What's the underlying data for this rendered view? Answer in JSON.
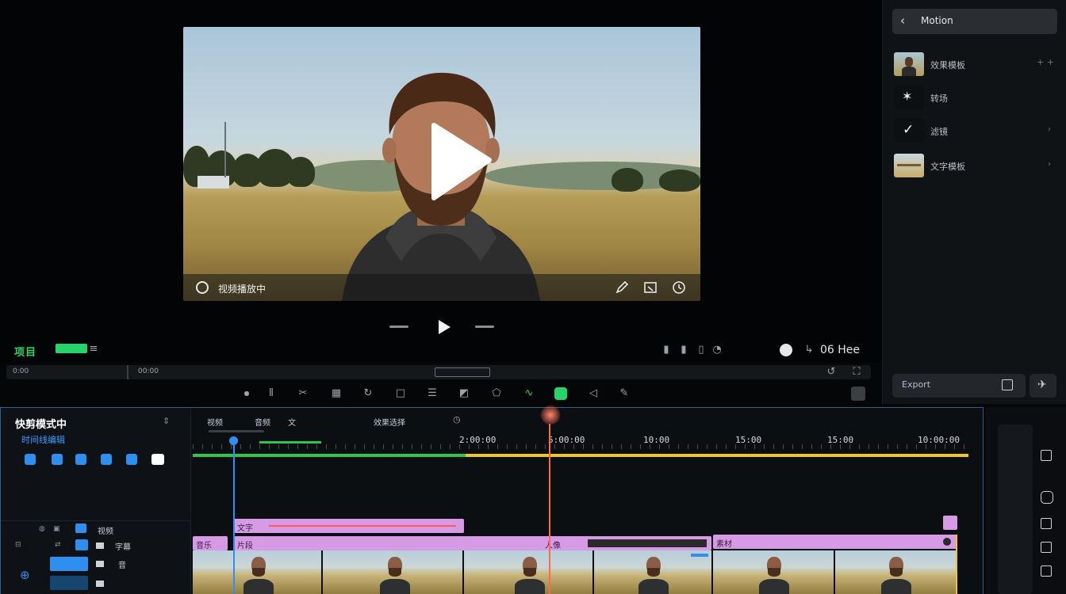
{
  "preview": {
    "caption": "视频播放中"
  },
  "toolbar": {
    "left_label": "项目",
    "row2_text_a": "0:00",
    "row2_text_b": "00:00",
    "right_label": "06 Hee"
  },
  "side_panel": {
    "title": "Motion",
    "items": [
      {
        "label": "效果模板"
      },
      {
        "label": "转场"
      },
      {
        "label": "滤镜"
      },
      {
        "label": "文字模板"
      }
    ],
    "action_label": "Export"
  },
  "timeline": {
    "title": "快剪模式中",
    "subtitle": "时间线编辑",
    "tabs": [
      "视频",
      "音频",
      "文"
    ],
    "tab_extra": "效果选择",
    "ruler_labels": [
      "2:00:00",
      "5:00:00",
      "10:00",
      "15:00",
      "15:00",
      "10:00:00"
    ],
    "track_label_main": "视频",
    "track_label_a": "字幕",
    "track_label_b": "音",
    "clip_label_1": "文字",
    "clip_label_2": "音乐",
    "clip_label_3": "片段",
    "clip_label_4": "人像",
    "clip_label_5": "素材"
  },
  "colors": {
    "accent_blue": "#2f8ff0",
    "playhead": "#ff6a4d",
    "track_green": "#2ec44d",
    "track_yellow": "#f2c524",
    "clip_pink": "#d79be6"
  }
}
